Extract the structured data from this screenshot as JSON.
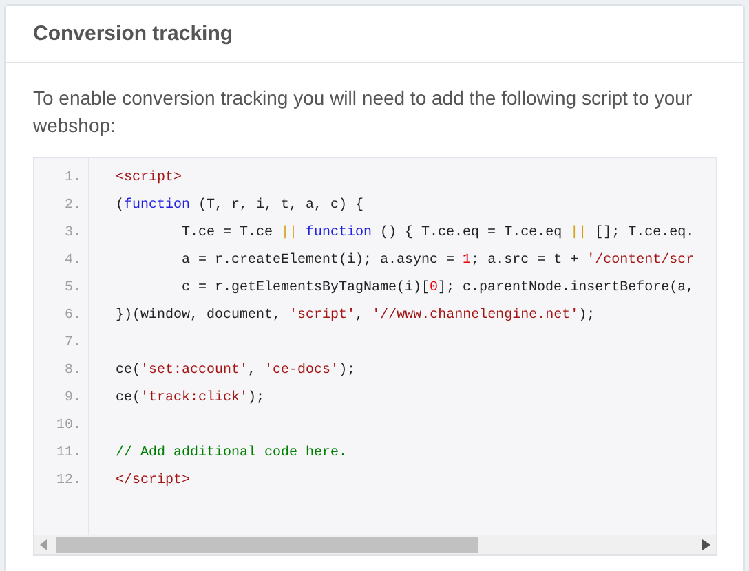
{
  "card": {
    "title": "Conversion tracking",
    "intro": "To enable conversion tracking you will need to add the following script to your webshop:"
  },
  "code": {
    "lines": [
      {
        "number": "1.",
        "indented": false,
        "tokens": [
          {
            "kind": "tag",
            "text": "<script>"
          }
        ]
      },
      {
        "number": "2.",
        "indented": false,
        "tokens": [
          {
            "kind": "plain",
            "text": "("
          },
          {
            "kind": "keyword",
            "text": "function"
          },
          {
            "kind": "plain",
            "text": " (T, r, i, t, a, c) {"
          }
        ]
      },
      {
        "number": "3.",
        "indented": true,
        "tokens": [
          {
            "kind": "plain",
            "text": "T.ce = T.ce "
          },
          {
            "kind": "operator",
            "text": "||"
          },
          {
            "kind": "keyword",
            "text": " function"
          },
          {
            "kind": "plain",
            "text": " () { T.ce.eq = T.ce.eq "
          },
          {
            "kind": "operator",
            "text": "||"
          },
          {
            "kind": "plain",
            "text": " []; T.ce.eq."
          }
        ]
      },
      {
        "number": "4.",
        "indented": true,
        "tokens": [
          {
            "kind": "plain",
            "text": "a = r.createElement(i); a.async = "
          },
          {
            "kind": "number",
            "text": "1"
          },
          {
            "kind": "plain",
            "text": "; a.src = t + "
          },
          {
            "kind": "string",
            "text": "'/content/scr"
          }
        ]
      },
      {
        "number": "5.",
        "indented": true,
        "tokens": [
          {
            "kind": "plain",
            "text": "c = r.getElementsByTagName(i)["
          },
          {
            "kind": "number",
            "text": "0"
          },
          {
            "kind": "plain",
            "text": "]; c.parentNode.insertBefore(a,"
          }
        ]
      },
      {
        "number": "6.",
        "indented": false,
        "tokens": [
          {
            "kind": "plain",
            "text": "})(window, document, "
          },
          {
            "kind": "string",
            "text": "'script'"
          },
          {
            "kind": "plain",
            "text": ", "
          },
          {
            "kind": "string",
            "text": "'//www.channelengine.net'"
          },
          {
            "kind": "plain",
            "text": ");"
          }
        ]
      },
      {
        "number": "7."
      },
      {
        "number": "8.",
        "indented": false,
        "tokens": [
          {
            "kind": "plain",
            "text": "ce("
          },
          {
            "kind": "string",
            "text": "'set:account'"
          },
          {
            "kind": "plain",
            "text": ", "
          },
          {
            "kind": "string",
            "text": "'ce-docs'"
          },
          {
            "kind": "plain",
            "text": ");"
          }
        ]
      },
      {
        "number": "9.",
        "indented": false,
        "tokens": [
          {
            "kind": "plain",
            "text": "ce("
          },
          {
            "kind": "string",
            "text": "'track:click'"
          },
          {
            "kind": "plain",
            "text": ");"
          }
        ]
      },
      {
        "number": "10."
      },
      {
        "number": "11.",
        "indented": false,
        "tokens": [
          {
            "kind": "comment",
            "text": "// Add additional code here."
          }
        ]
      },
      {
        "number": "12.",
        "indented": false,
        "tokens": [
          {
            "kind": "tag",
            "text": "</script>"
          }
        ]
      }
    ]
  }
}
